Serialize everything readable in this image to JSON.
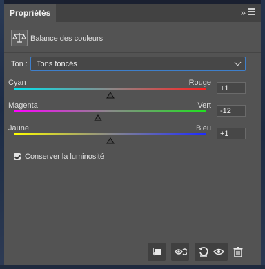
{
  "panel": {
    "tab_title": "Propriétés",
    "collapse_glyph": "»",
    "adjustment_label": "Balance des couleurs",
    "adjustment_icon": "balance-scale-icon"
  },
  "tone": {
    "label": "Ton :",
    "selected": "Tons foncés"
  },
  "sliders": [
    {
      "left_label": "Cyan",
      "right_label": "Rouge",
      "value": "+1",
      "left_color": "#00e5f0",
      "right_color": "#ff2020"
    },
    {
      "left_label": "Magenta",
      "right_label": "Vert",
      "value": "-12",
      "left_color": "#ff00ff",
      "right_color": "#20e020"
    },
    {
      "left_label": "Jaune",
      "right_label": "Bleu",
      "value": "+1",
      "left_color": "#ffff00",
      "right_color": "#1e2bff"
    }
  ],
  "preserve_luminosity": {
    "label": "Conserver la luminosité",
    "checked": true
  },
  "footer_buttons": [
    "clip-to-layer-icon",
    "view-previous-state-icon",
    "reset-icon",
    "visibility-icon",
    "trash-icon"
  ]
}
